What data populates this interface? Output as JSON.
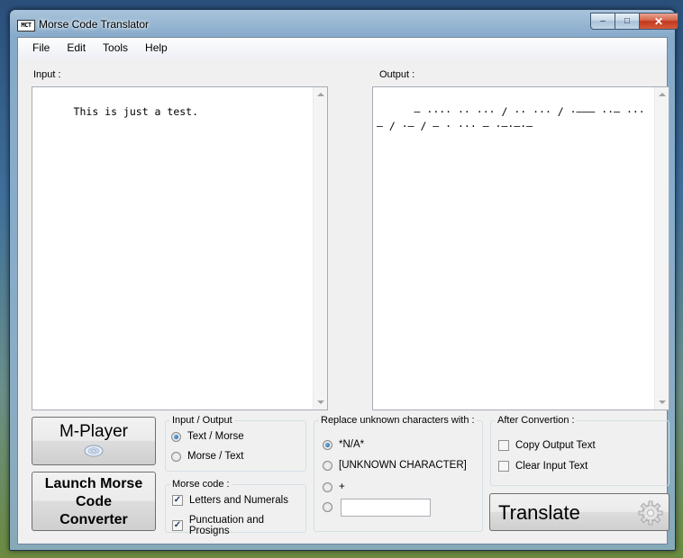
{
  "window": {
    "title": "Morse Code Translator",
    "icon_text": "MCT",
    "controls": {
      "minimize": "–",
      "maximize": "□",
      "close": "✕"
    }
  },
  "menu": [
    "File",
    "Edit",
    "Tools",
    "Help"
  ],
  "input": {
    "label": "Input :",
    "value": "This is just a test."
  },
  "output": {
    "label": "Output :",
    "value": "– ···· ·· ··· / ·· ··· / ·––– ··– ··· – / ·– / – · ··· – ·–·–·–"
  },
  "buttons": {
    "mplayer": "M-Player",
    "mplayer_icon": "cd-icon",
    "launch_line1": "Launch Morse",
    "launch_line2": "Code",
    "launch_line3": "Converter",
    "translate": "Translate",
    "translate_icon": "gear-icon"
  },
  "io_group": {
    "title": "Input / Output",
    "options": [
      {
        "label": "Text / Morse",
        "selected": true
      },
      {
        "label": "Morse / Text",
        "selected": false
      }
    ]
  },
  "morse_group": {
    "title": "Morse code :",
    "options": [
      {
        "label": "Letters and Numerals",
        "checked": true
      },
      {
        "label": "Punctuation and Prosigns",
        "checked": true
      }
    ]
  },
  "replace_group": {
    "title": "Replace unknown characters with :",
    "options": [
      {
        "label": "*N/A*",
        "selected": true
      },
      {
        "label": "[UNKNOWN CHARACTER]",
        "selected": false
      },
      {
        "label": "+",
        "selected": false
      },
      {
        "label": "",
        "selected": false
      }
    ],
    "custom_value": ""
  },
  "after_group": {
    "title": "After Convertion :",
    "options": [
      {
        "label": "Copy Output Text",
        "checked": false
      },
      {
        "label": "Clear Input Text",
        "checked": false
      }
    ]
  }
}
